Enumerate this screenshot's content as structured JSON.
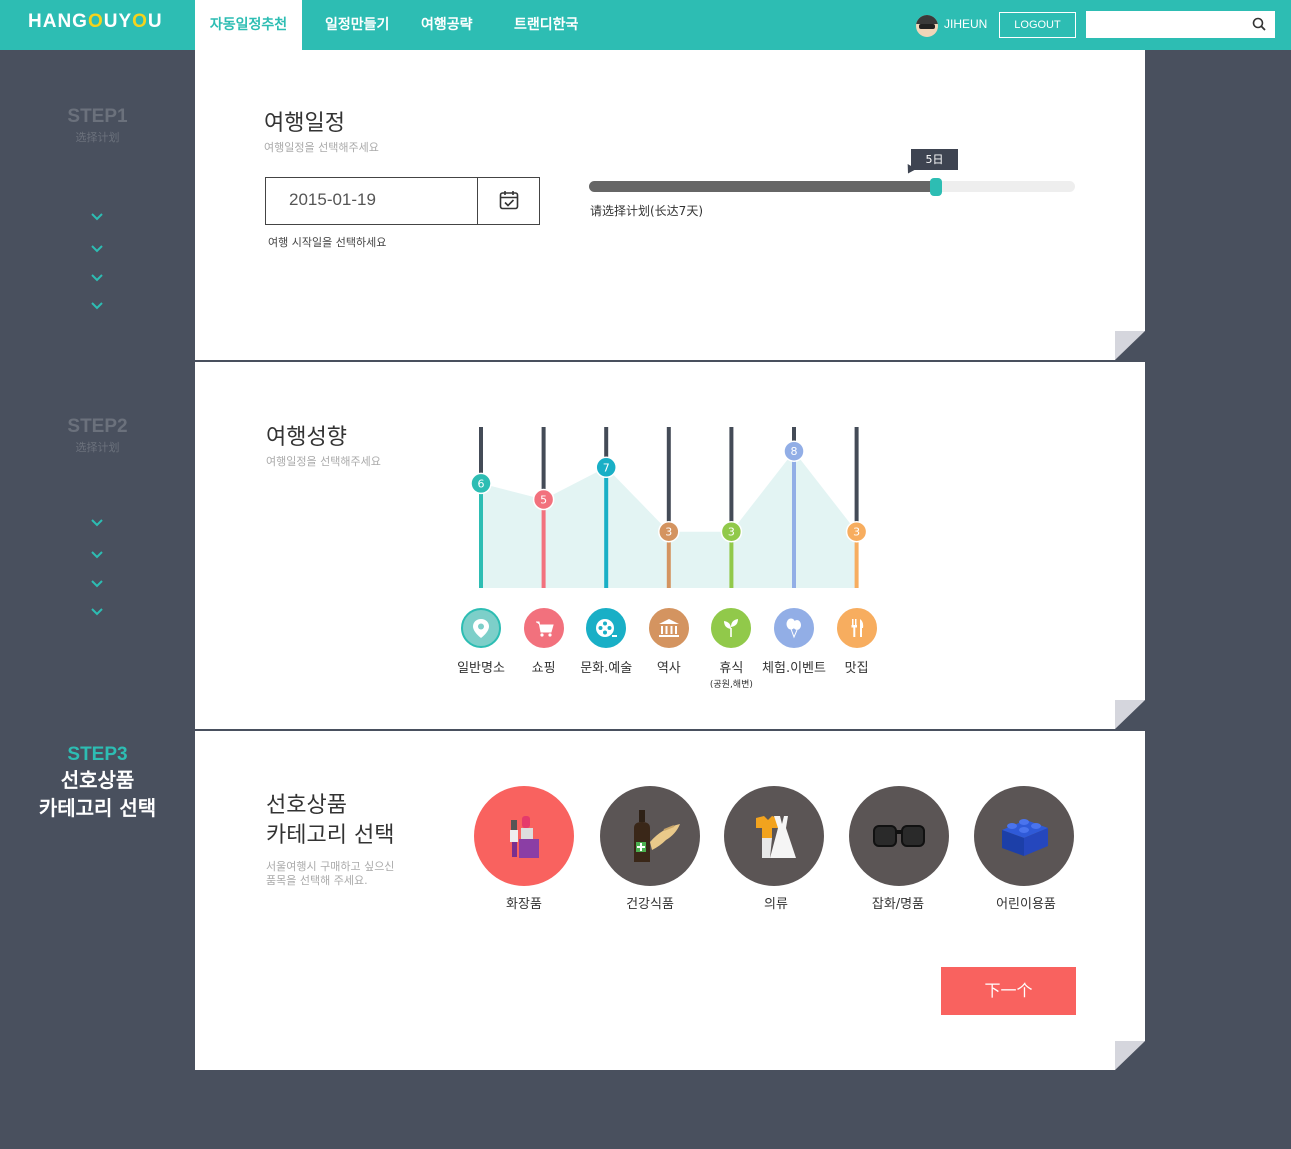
{
  "header": {
    "logo_parts": [
      "HANG",
      "O",
      "UY",
      "O",
      "U"
    ],
    "nav": [
      "자동일정추천",
      "일정만들기",
      "여행공략",
      "트랜디한국"
    ],
    "username": "JIHEUN",
    "logout_label": "LOGOUT",
    "search_value": "",
    "colors": {
      "brand": "#2dbdb3",
      "accent": "#f5d31c"
    }
  },
  "sidebar": {
    "step1": {
      "title": "STEP1",
      "sub": "选择计划"
    },
    "step2": {
      "title": "STEP2",
      "sub": "选择计划"
    },
    "step3": {
      "title": "STEP3",
      "line1": "선호상품",
      "line2": "카테고리 선택"
    }
  },
  "schedule": {
    "title": "여행일정",
    "desc": "여행일정을 선택해주세요",
    "date_value": "2015-01-19",
    "date_hint": "여행 시작일을 선택하세요",
    "slider_value": 5,
    "slider_max": 7,
    "slider_label": "5日",
    "slider_caption": "请选择计划(长达7天)"
  },
  "preference": {
    "title": "여행성향",
    "desc": "여행일정을 선택해주세요",
    "max": 10,
    "items": [
      {
        "label": "일반명소",
        "value": 6,
        "color": "#2dbdb3",
        "icon": "map-pin-icon"
      },
      {
        "label": "쇼핑",
        "value": 5,
        "color": "#f2717d",
        "icon": "cart-icon"
      },
      {
        "label": "문화.예술",
        "value": 7,
        "color": "#19afc6",
        "icon": "film-reel-icon"
      },
      {
        "label": "역사",
        "value": 3,
        "color": "#d49460",
        "icon": "museum-icon"
      },
      {
        "label": "휴식",
        "sub": "(공원,해변)",
        "value": 3,
        "color": "#91c94a",
        "icon": "leaf-icon"
      },
      {
        "label": "체험.이벤트",
        "value": 8,
        "color": "#92aee6",
        "icon": "balloon-icon"
      },
      {
        "label": "맛집",
        "value": 3,
        "color": "#f7ad5f",
        "icon": "fork-knife-icon"
      }
    ]
  },
  "products": {
    "title_line1": "선호상품",
    "title_line2": "카테고리 선택",
    "desc_line1": "서울여행시 구매하고 싶으신",
    "desc_line2": "품목을 선택해 주세요.",
    "items": [
      {
        "label": "화장품",
        "icon": "cosmetics-icon",
        "color": "#f9625f",
        "selected": true
      },
      {
        "label": "건강식품",
        "icon": "ginseng-bottle-icon",
        "color": "#5b5555",
        "selected": false
      },
      {
        "label": "의류",
        "icon": "clothing-icon",
        "color": "#5b5555",
        "selected": false
      },
      {
        "label": "잡화/명품",
        "icon": "sunglasses-icon",
        "color": "#5b5555",
        "selected": false
      },
      {
        "label": "어린이용품",
        "icon": "toy-brick-icon",
        "color": "#5b5555",
        "selected": false
      }
    ],
    "next_label": "下一个"
  }
}
